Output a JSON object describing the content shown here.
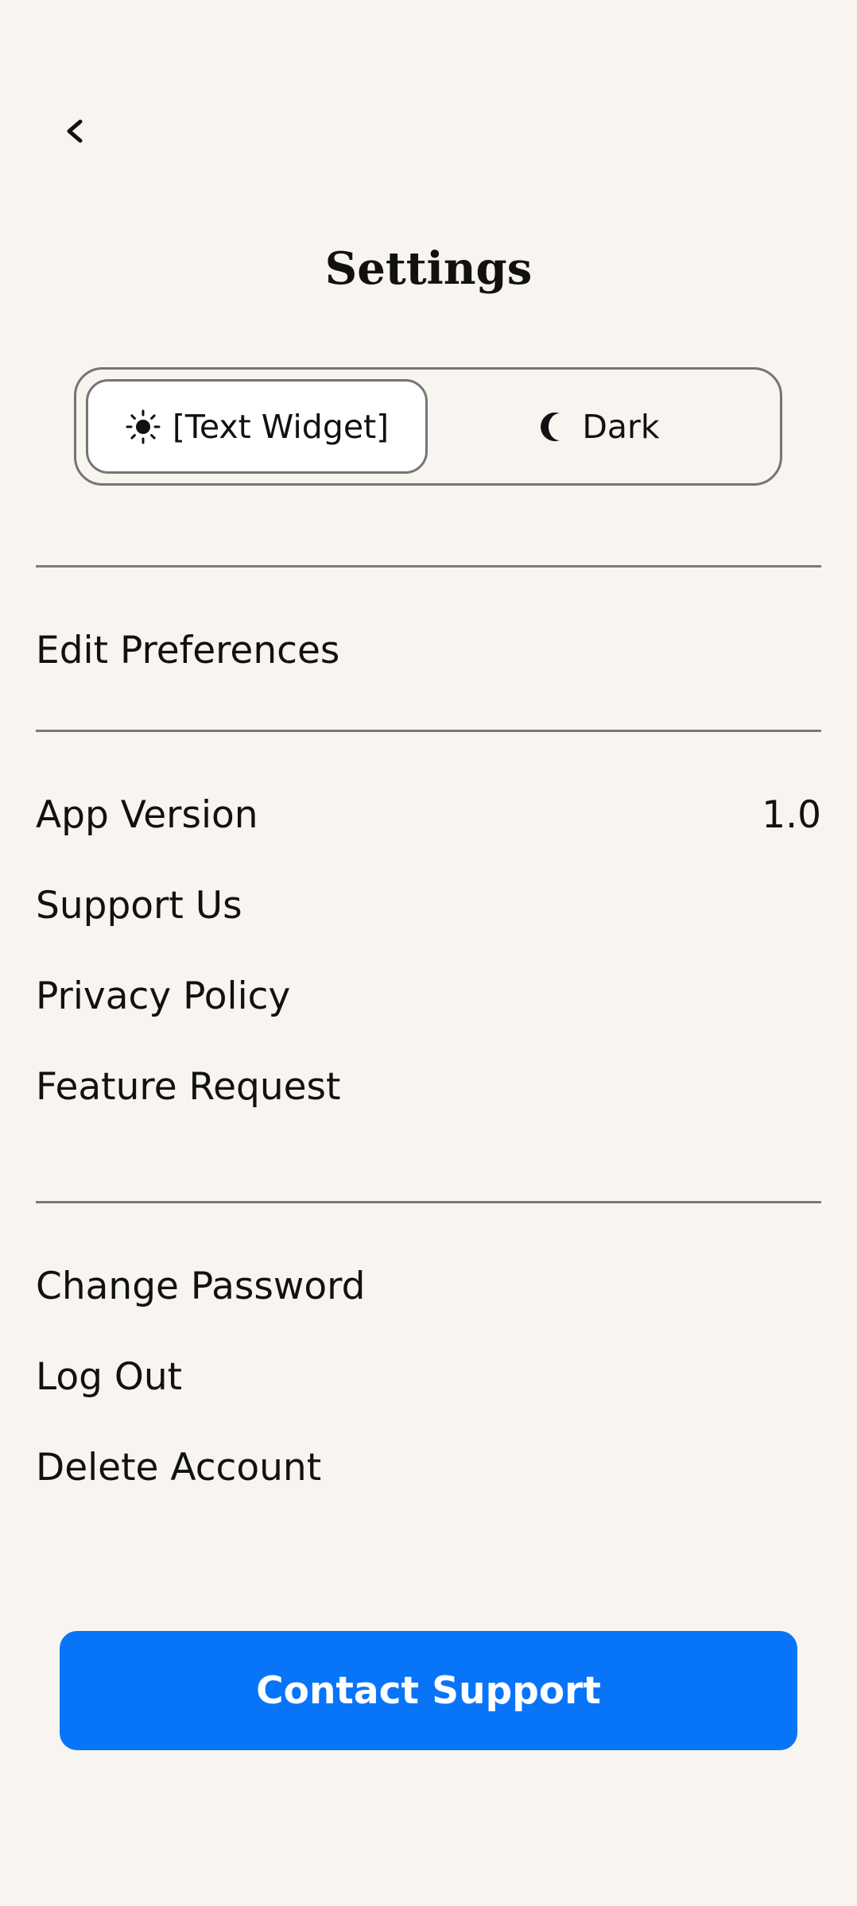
{
  "header": {
    "back_icon": "chevron-left-icon",
    "title": "Settings"
  },
  "theme_toggle": {
    "light": {
      "icon": "sun-icon",
      "label": "[Text Widget]",
      "selected": true
    },
    "dark": {
      "icon": "moon-icon",
      "label": "Dark",
      "selected": false
    }
  },
  "sections": {
    "preferences": {
      "edit_preferences": "Edit Preferences"
    },
    "about": {
      "app_version_label": "App Version",
      "app_version_value": "1.0",
      "support_us": "Support Us",
      "privacy_policy": "Privacy Policy",
      "feature_request": "Feature Request"
    },
    "account": {
      "change_password": "Change Password",
      "log_out": "Log Out",
      "delete_account": "Delete Account"
    }
  },
  "contact_button": {
    "label": "Contact Support"
  },
  "colors": {
    "background": "#f8f4ef",
    "accent": "#0875f9",
    "border": "#757575",
    "text": "#111111"
  }
}
